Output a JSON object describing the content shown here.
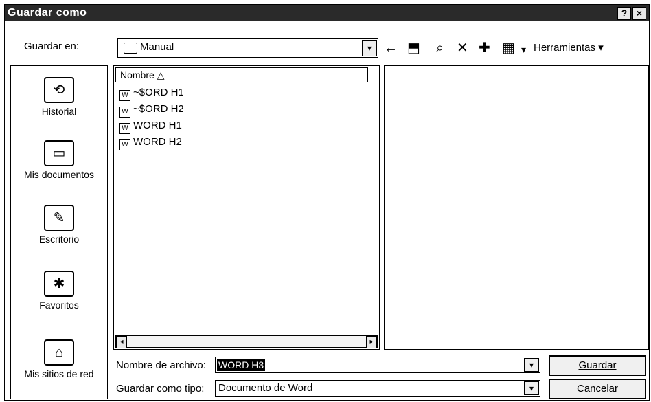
{
  "window": {
    "title": "Guardar como",
    "help_label": "?",
    "close_label": "×"
  },
  "toolbar": {
    "save_in_label": "Guardar en:",
    "save_in_value": "Manual",
    "back_label": "←",
    "up_label": "⬒",
    "search_label": "⌕",
    "delete_label": "✕",
    "new_folder_label": "✚",
    "views_label": "▦",
    "tools_label": "Herramientas",
    "dropdown_arrow": "▾"
  },
  "places": [
    {
      "label": "Historial",
      "icon": "history-icon"
    },
    {
      "label": "Mis documentos",
      "icon": "my-documents-icon"
    },
    {
      "label": "Escritorio",
      "icon": "desktop-icon"
    },
    {
      "label": "Favoritos",
      "icon": "favorites-icon"
    },
    {
      "label": "Mis sitios de red",
      "icon": "network-places-icon"
    }
  ],
  "filelist": {
    "column_header": "Nombre",
    "sort_indicator": "△",
    "files": [
      "~$ORD H1",
      "~$ORD H2",
      "WORD H1",
      "WORD H2"
    ]
  },
  "bottom": {
    "filename_label": "Nombre de archivo:",
    "filename_value": "WORD H3",
    "filetype_label": "Guardar como tipo:",
    "filetype_value": "Documento de Word",
    "save_button": "Guardar",
    "cancel_button": "Cancelar"
  }
}
